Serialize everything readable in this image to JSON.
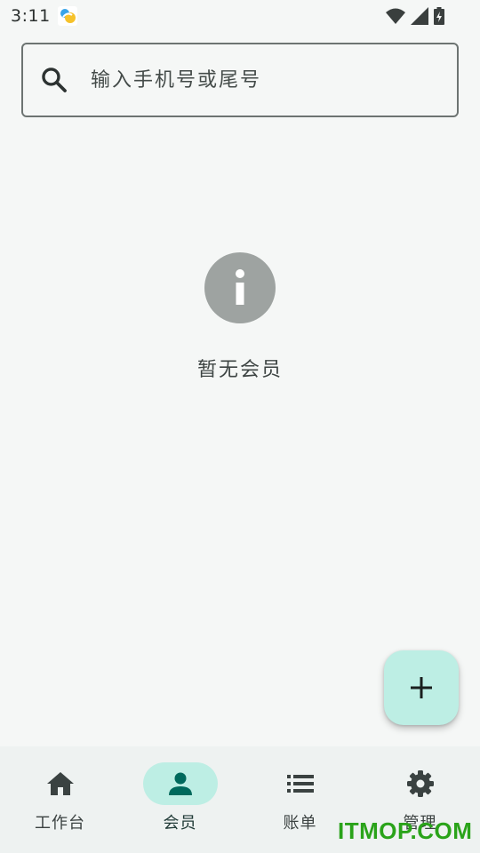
{
  "status_bar": {
    "time": "3:11",
    "app_icon": "gradient-app-icon",
    "icons": [
      "wifi-icon",
      "signal-icon",
      "battery-charging-icon"
    ]
  },
  "search": {
    "placeholder": "输入手机号或尾号",
    "value": "",
    "icon": "search-icon"
  },
  "empty_state": {
    "icon": "info-icon",
    "message": "暂无会员"
  },
  "fab": {
    "icon": "plus-icon"
  },
  "bottom_nav": {
    "items": [
      {
        "label": "工作台",
        "icon": "home-icon",
        "active": false
      },
      {
        "label": "会员",
        "icon": "person-icon",
        "active": true
      },
      {
        "label": "账单",
        "icon": "list-icon",
        "active": false
      },
      {
        "label": "管理",
        "icon": "gear-icon",
        "active": false
      }
    ]
  },
  "watermark": "ITMOP.COM",
  "colors": {
    "background": "#f5f7f6",
    "accent": "#bdeee4",
    "active_icon": "#00695c",
    "info_icon": "#9ea3a1",
    "watermark": "#2aa31a"
  }
}
